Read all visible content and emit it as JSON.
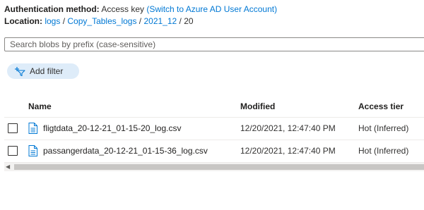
{
  "header": {
    "auth_label": "Authentication method:",
    "auth_value": "Access key",
    "auth_link": "(Switch to Azure AD User Account)",
    "location_label": "Location:",
    "breadcrumb": [
      "logs",
      "Copy_Tables_logs",
      "2021_12",
      "20"
    ],
    "separator": "/"
  },
  "search": {
    "placeholder": "Search blobs by prefix (case-sensitive)",
    "value": ""
  },
  "add_filter": {
    "label": "Add filter",
    "icon": "add-filter-icon"
  },
  "table": {
    "columns": [
      "Name",
      "Modified",
      "Access tier"
    ],
    "rows": [
      {
        "name": "fligtdata_20-12-21_01-15-20_log.csv",
        "modified": "12/20/2021, 12:47:40 PM",
        "tier": "Hot (Inferred)",
        "icon": "file-icon"
      },
      {
        "name": "passangerdata_20-12-21_01-15-36_log.csv",
        "modified": "12/20/2021, 12:47:40 PM",
        "tier": "Hot (Inferred)",
        "icon": "file-icon"
      }
    ]
  },
  "colors": {
    "link": "#0078d4",
    "filter_bg": "#deecf9",
    "border": "#edebe9"
  }
}
